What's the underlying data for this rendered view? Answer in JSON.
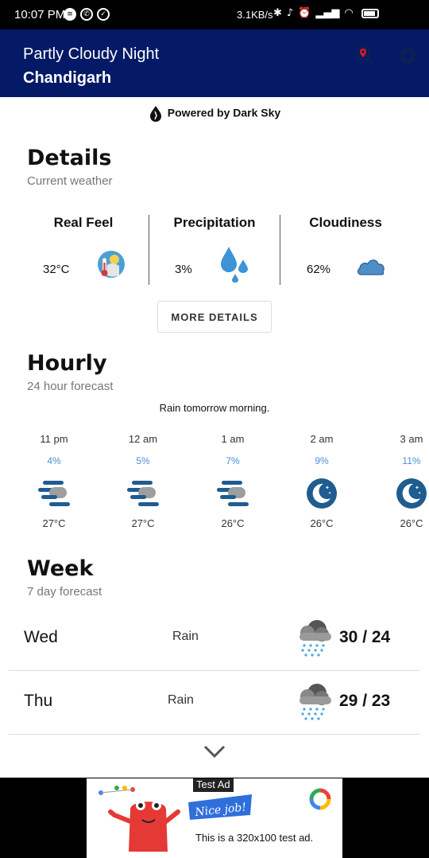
{
  "status_bar": {
    "time": "10:07 PM",
    "network_speed": "3.1KB/s"
  },
  "app_bar": {
    "condition": "Partly Cloudy Night",
    "city": "Chandigarh",
    "location_icon": "location-search-icon",
    "settings_icon": "gear-icon"
  },
  "powered_by": "Powered by Dark Sky",
  "details": {
    "title": "Details",
    "subtitle": "Current weather",
    "metrics": [
      {
        "label": "Real Feel",
        "value": "32°C",
        "icon": "thermometer-sun-icon"
      },
      {
        "label": "Precipitation",
        "value": "3%",
        "icon": "raindrops-icon"
      },
      {
        "label": "Cloudiness",
        "value": "62%",
        "icon": "cloud-icon"
      }
    ],
    "more_button": "MORE DETAILS"
  },
  "hourly": {
    "title": "Hourly",
    "subtitle": "24 hour forecast",
    "summary": "Rain tomorrow morning.",
    "items": [
      {
        "time": "11 pm",
        "precip": "4%",
        "temp": "27°C",
        "icon": "fog-icon"
      },
      {
        "time": "12 am",
        "precip": "5%",
        "temp": "27°C",
        "icon": "fog-icon"
      },
      {
        "time": "1 am",
        "precip": "7%",
        "temp": "26°C",
        "icon": "fog-icon"
      },
      {
        "time": "2 am",
        "precip": "9%",
        "temp": "26°C",
        "icon": "clear-night-icon"
      },
      {
        "time": "3 am",
        "precip": "11%",
        "temp": "26°C",
        "icon": "clear-night-icon"
      }
    ]
  },
  "week": {
    "title": "Week",
    "subtitle": "7 day forecast",
    "days": [
      {
        "day": "Wed",
        "condition": "Rain",
        "temps": "30 / 24",
        "icon": "rain-cloud-icon"
      },
      {
        "day": "Thu",
        "condition": "Rain",
        "temps": "29 / 23",
        "icon": "rain-cloud-icon"
      }
    ],
    "expand_icon": "chevron-down-icon"
  },
  "ad": {
    "badge": "Test Ad",
    "banner": "Nice job!",
    "text": "This is a 320x100 test ad."
  },
  "colors": {
    "app_bar": "#041a66",
    "accent_blue": "#4a8fd6",
    "icon_blue": "#1f5c8f"
  }
}
